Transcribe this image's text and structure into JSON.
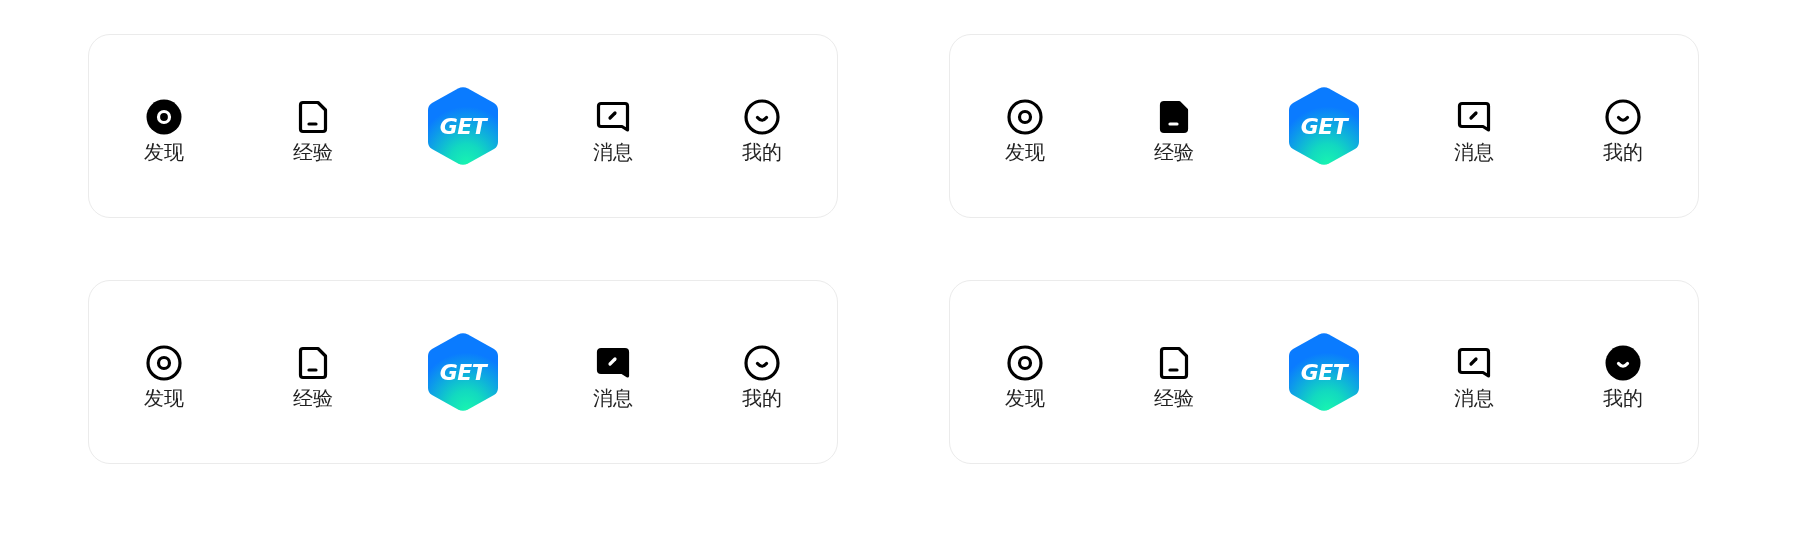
{
  "tab_bars": [
    {
      "items": [
        {
          "kind": "tab",
          "label": "发现",
          "selected": true
        },
        {
          "kind": "tab",
          "label": "经验",
          "selected": false
        },
        {
          "kind": "get",
          "label": "GET"
        },
        {
          "kind": "tab",
          "label": "消息",
          "selected": false
        },
        {
          "kind": "tab",
          "label": "我的",
          "selected": false
        }
      ]
    },
    {
      "items": [
        {
          "kind": "tab",
          "label": "发现",
          "selected": false
        },
        {
          "kind": "tab",
          "label": "经验",
          "selected": true
        },
        {
          "kind": "get",
          "label": "GET"
        },
        {
          "kind": "tab",
          "label": "消息",
          "selected": false
        },
        {
          "kind": "tab",
          "label": "我的",
          "selected": false
        }
      ]
    },
    {
      "items": [
        {
          "kind": "tab",
          "label": "发现",
          "selected": false
        },
        {
          "kind": "tab",
          "label": "经验",
          "selected": false
        },
        {
          "kind": "get",
          "label": "GET"
        },
        {
          "kind": "tab",
          "label": "消息",
          "selected": true
        },
        {
          "kind": "tab",
          "label": "我的",
          "selected": false
        }
      ]
    },
    {
      "items": [
        {
          "kind": "tab",
          "label": "发现",
          "selected": false
        },
        {
          "kind": "tab",
          "label": "经验",
          "selected": false
        },
        {
          "kind": "get",
          "label": "GET"
        },
        {
          "kind": "tab",
          "label": "消息",
          "selected": false
        },
        {
          "kind": "tab",
          "label": "我的",
          "selected": true
        }
      ]
    }
  ]
}
